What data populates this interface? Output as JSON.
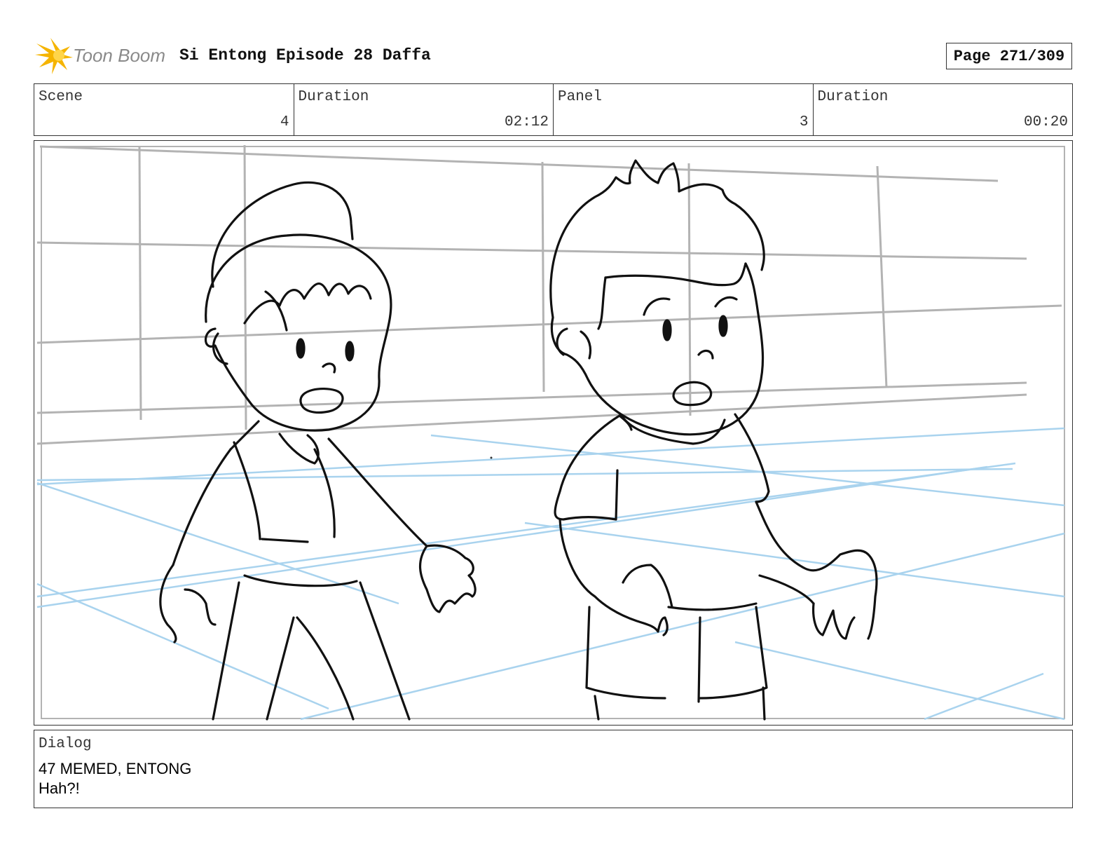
{
  "header": {
    "logo_text": "Toon Boom",
    "title": "Si Entong Episode 28 Daffa",
    "page": "Page 271/309"
  },
  "info": {
    "scene_label": "Scene",
    "scene_value": "4",
    "scene_duration_label": "Duration",
    "scene_duration_value": "02:12",
    "panel_label": "Panel",
    "panel_value": "3",
    "panel_duration_label": "Duration",
    "panel_duration_value": "00:20"
  },
  "dialog": {
    "label": "Dialog",
    "line1": "47 MEMED, ENTONG",
    "line2": "Hah?!"
  },
  "colors": {
    "logo_accent": "#f5b400",
    "grid_gray": "#b3b3b3",
    "floor_blue": "#a9d3ee",
    "ink": "#111111"
  }
}
